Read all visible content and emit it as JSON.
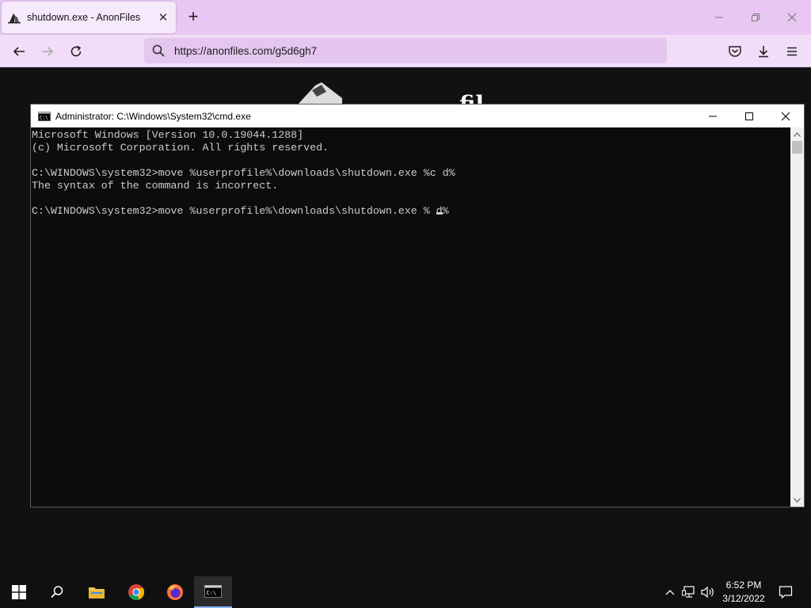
{
  "browser": {
    "tab": {
      "title": "shutdown.exe - AnonFiles",
      "favicon": "anonfiles-icon"
    },
    "new_tab_label": "+",
    "url": "https://anonfiles.com/g5d6gh7",
    "colors": {
      "tabbar": "#e8c8f2",
      "navbar": "#f1ddf7",
      "urlbar": "#e4c6ef"
    }
  },
  "page": {
    "heading": "fil"
  },
  "cmd": {
    "title": "Administrator: C:\\Windows\\System32\\cmd.exe",
    "lines": [
      "Microsoft Windows [Version 10.0.19044.1288]",
      "(c) Microsoft Corporation. All rights reserved.",
      "",
      "C:\\WINDOWS\\system32>move %userprofile%\\downloads\\shutdown.exe %c d%",
      "The syntax of the command is incorrect.",
      "",
      "C:\\WINDOWS\\system32>move %userprofile%\\downloads\\shutdown.exe % d%"
    ],
    "colors": {
      "background": "#0c0c0c",
      "text": "#cccccc"
    }
  },
  "taskbar": {
    "time": "6:52 PM",
    "date": "3/12/2022",
    "items": [
      "start-icon",
      "search-icon",
      "file-explorer-icon",
      "chrome-icon",
      "firefox-icon",
      "cmd-icon"
    ]
  }
}
